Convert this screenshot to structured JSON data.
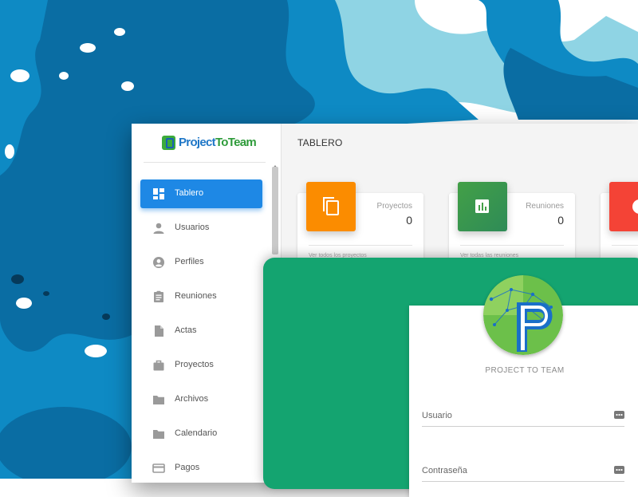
{
  "dashboard": {
    "logo": {
      "text_a": "Project",
      "text_b": "ToTeam"
    },
    "title": "TABLERO",
    "sidebar": {
      "items": [
        {
          "label": "Tablero",
          "icon": "dashboard-icon",
          "active": true
        },
        {
          "label": "Usuarios",
          "icon": "person-icon"
        },
        {
          "label": "Perfiles",
          "icon": "account-circle-icon"
        },
        {
          "label": "Reuniones",
          "icon": "assignment-icon"
        },
        {
          "label": "Actas",
          "icon": "document-icon"
        },
        {
          "label": "Proyectos",
          "icon": "briefcase-icon"
        },
        {
          "label": "Archivos",
          "icon": "folder-icon"
        },
        {
          "label": "Calendario",
          "icon": "folder-icon"
        },
        {
          "label": "Pagos",
          "icon": "credit-card-icon"
        }
      ]
    },
    "cards": [
      {
        "name": "Proyectos",
        "value": "0",
        "color": "#fb8c00",
        "icon": "copy-icon",
        "footer": "Ver todos los proyectos"
      },
      {
        "name": "Reuniones",
        "value": "0",
        "color": "#43a047",
        "icon": "bar-chart-icon",
        "footer": "Ver todas las reuniones"
      },
      {
        "name": "",
        "value": "",
        "color": "#f44336",
        "icon": "info-icon",
        "footer": ""
      }
    ]
  },
  "login": {
    "brand": "PROJECT TO TEAM",
    "username": {
      "placeholder": "Usuario",
      "value": ""
    },
    "password": {
      "placeholder": "Contraseña",
      "value": ""
    }
  },
  "colors": {
    "accent": "#1e88e5",
    "login_bg": "#14a470",
    "splash_dark": "#0a6da3",
    "splash_mid": "#0e8ac4",
    "splash_light": "#8ad6e3"
  }
}
